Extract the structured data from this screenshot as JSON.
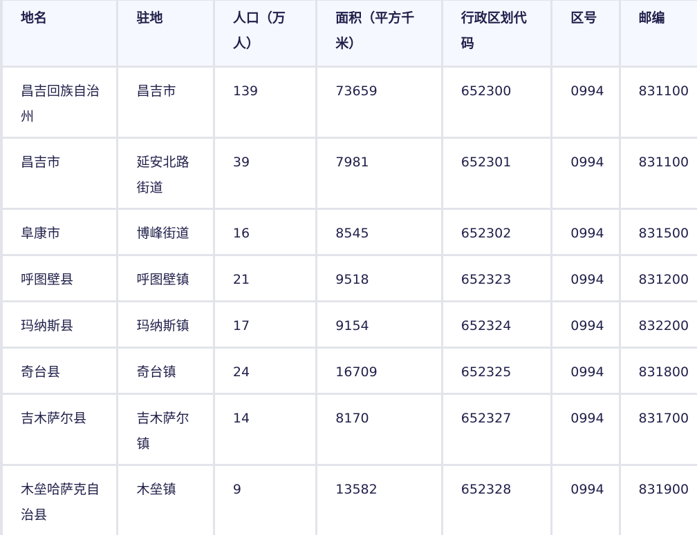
{
  "table": {
    "headers": [
      "地名",
      "驻地",
      "人口（万人）",
      "面积（平方千米）",
      "行政区划代码",
      "区号",
      "邮编"
    ],
    "rows": [
      [
        "昌吉回族自治州",
        "昌吉市",
        "139",
        "73659",
        "652300",
        "0994",
        "831100"
      ],
      [
        "昌吉市",
        "延安北路街道",
        "39",
        "7981",
        "652301",
        "0994",
        "831100"
      ],
      [
        "阜康市",
        "博峰街道",
        "16",
        "8545",
        "652302",
        "0994",
        "831500"
      ],
      [
        "呼图壁县",
        "呼图壁镇",
        "21",
        "9518",
        "652323",
        "0994",
        "831200"
      ],
      [
        "玛纳斯县",
        "玛纳斯镇",
        "17",
        "9154",
        "652324",
        "0994",
        "832200"
      ],
      [
        "奇台县",
        "奇台镇",
        "24",
        "16709",
        "652325",
        "0994",
        "831800"
      ],
      [
        "吉木萨尔县",
        "吉木萨尔镇",
        "14",
        "8170",
        "652327",
        "0994",
        "831700"
      ],
      [
        "木垒哈萨克自治县",
        "木垒镇",
        "9",
        "13582",
        "652328",
        "0994",
        "831900"
      ]
    ]
  }
}
